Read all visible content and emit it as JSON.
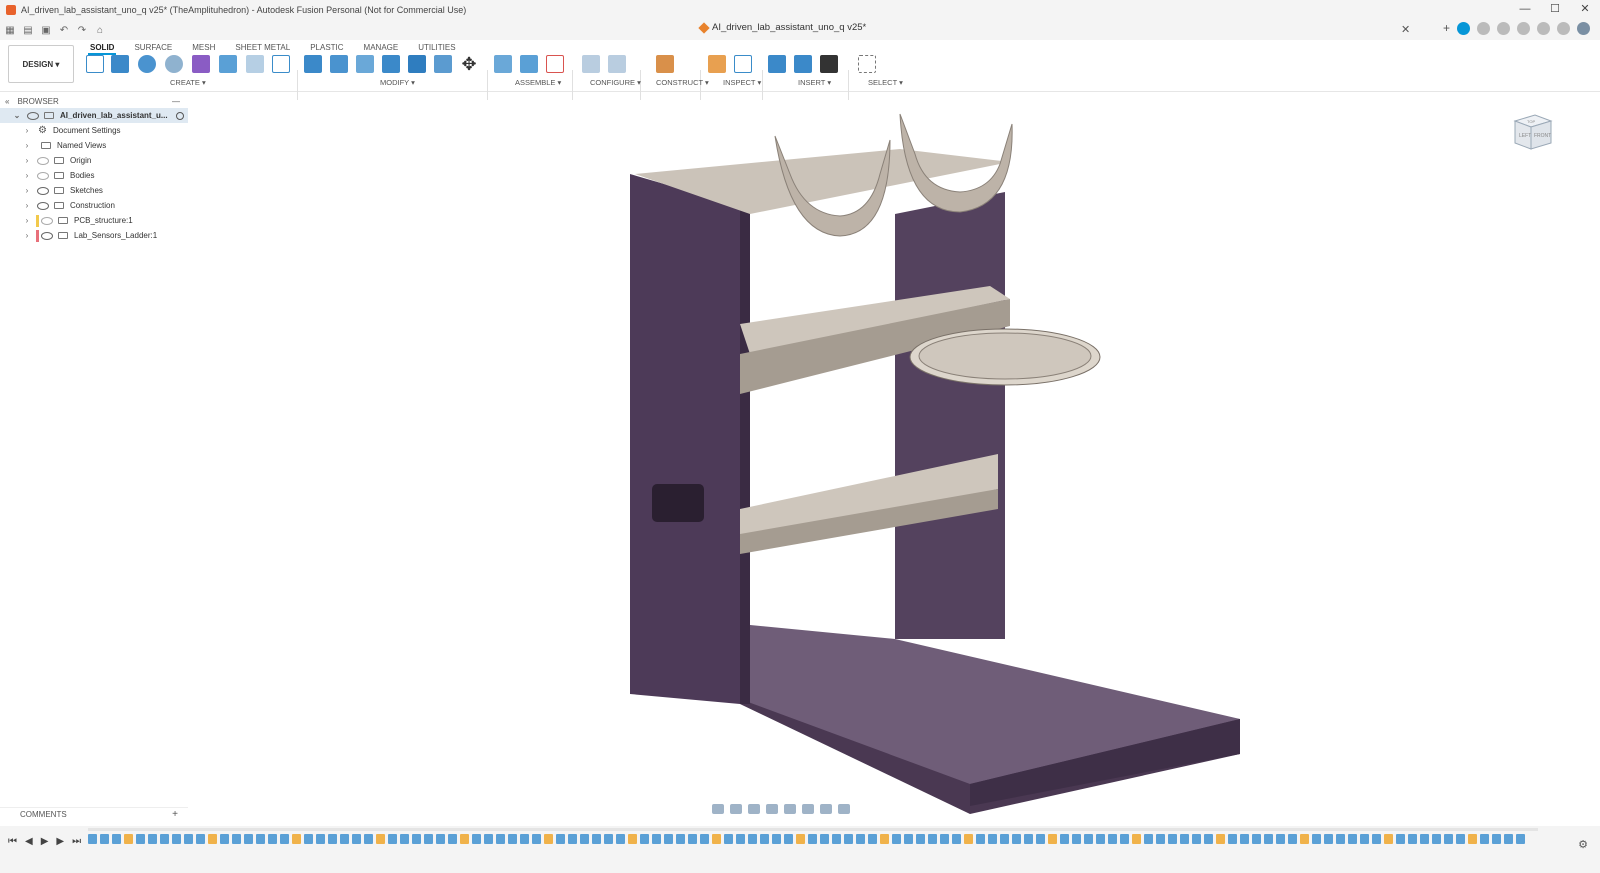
{
  "window": {
    "title": "AI_driven_lab_assistant_uno_q v25* (TheAmplituhedron) - Autodesk Fusion Personal (Not for Commercial Use)",
    "controls": [
      "—",
      "☐",
      "✕"
    ]
  },
  "document_tab": {
    "label": "AI_driven_lab_assistant_uno_q v25*",
    "close": "✕"
  },
  "ribbon": {
    "design_button": "DESIGN ▾",
    "tabs": [
      "SOLID",
      "SURFACE",
      "MESH",
      "SHEET METAL",
      "PLASTIC",
      "MANAGE",
      "UTILITIES"
    ],
    "active_tab": "SOLID",
    "groups": [
      "CREATE ▾",
      "MODIFY ▾",
      "ASSEMBLE ▾",
      "CONFIGURE ▾",
      "CONSTRUCT ▾",
      "INSPECT ▾",
      "INSERT ▾",
      "SELECT ▾"
    ]
  },
  "browser": {
    "header": "BROWSER",
    "items": [
      {
        "label": "AI_driven_lab_assistant_u...",
        "icon": "component-icon"
      },
      {
        "label": "Document Settings",
        "icon": "gear-icon"
      },
      {
        "label": "Named Views",
        "icon": "folder-icon"
      },
      {
        "label": "Origin",
        "icon": "folder-icon"
      },
      {
        "label": "Bodies",
        "icon": "folder-icon"
      },
      {
        "label": "Sketches",
        "icon": "folder-icon"
      },
      {
        "label": "Construction",
        "icon": "folder-icon"
      },
      {
        "label": "PCB_structure:1",
        "icon": "component-icon"
      },
      {
        "label": "Lab_Sensors_Ladder:1",
        "icon": "component-icon"
      }
    ]
  },
  "comments": {
    "label": "COMMENTS",
    "add": "+"
  },
  "viewcube": {
    "top": "TOP",
    "front": "FRONT",
    "left": "LEFT"
  },
  "colors": {
    "accent": "#0696d7",
    "model_purple": "#4d3a58",
    "model_beige": "#c7bfb5"
  }
}
